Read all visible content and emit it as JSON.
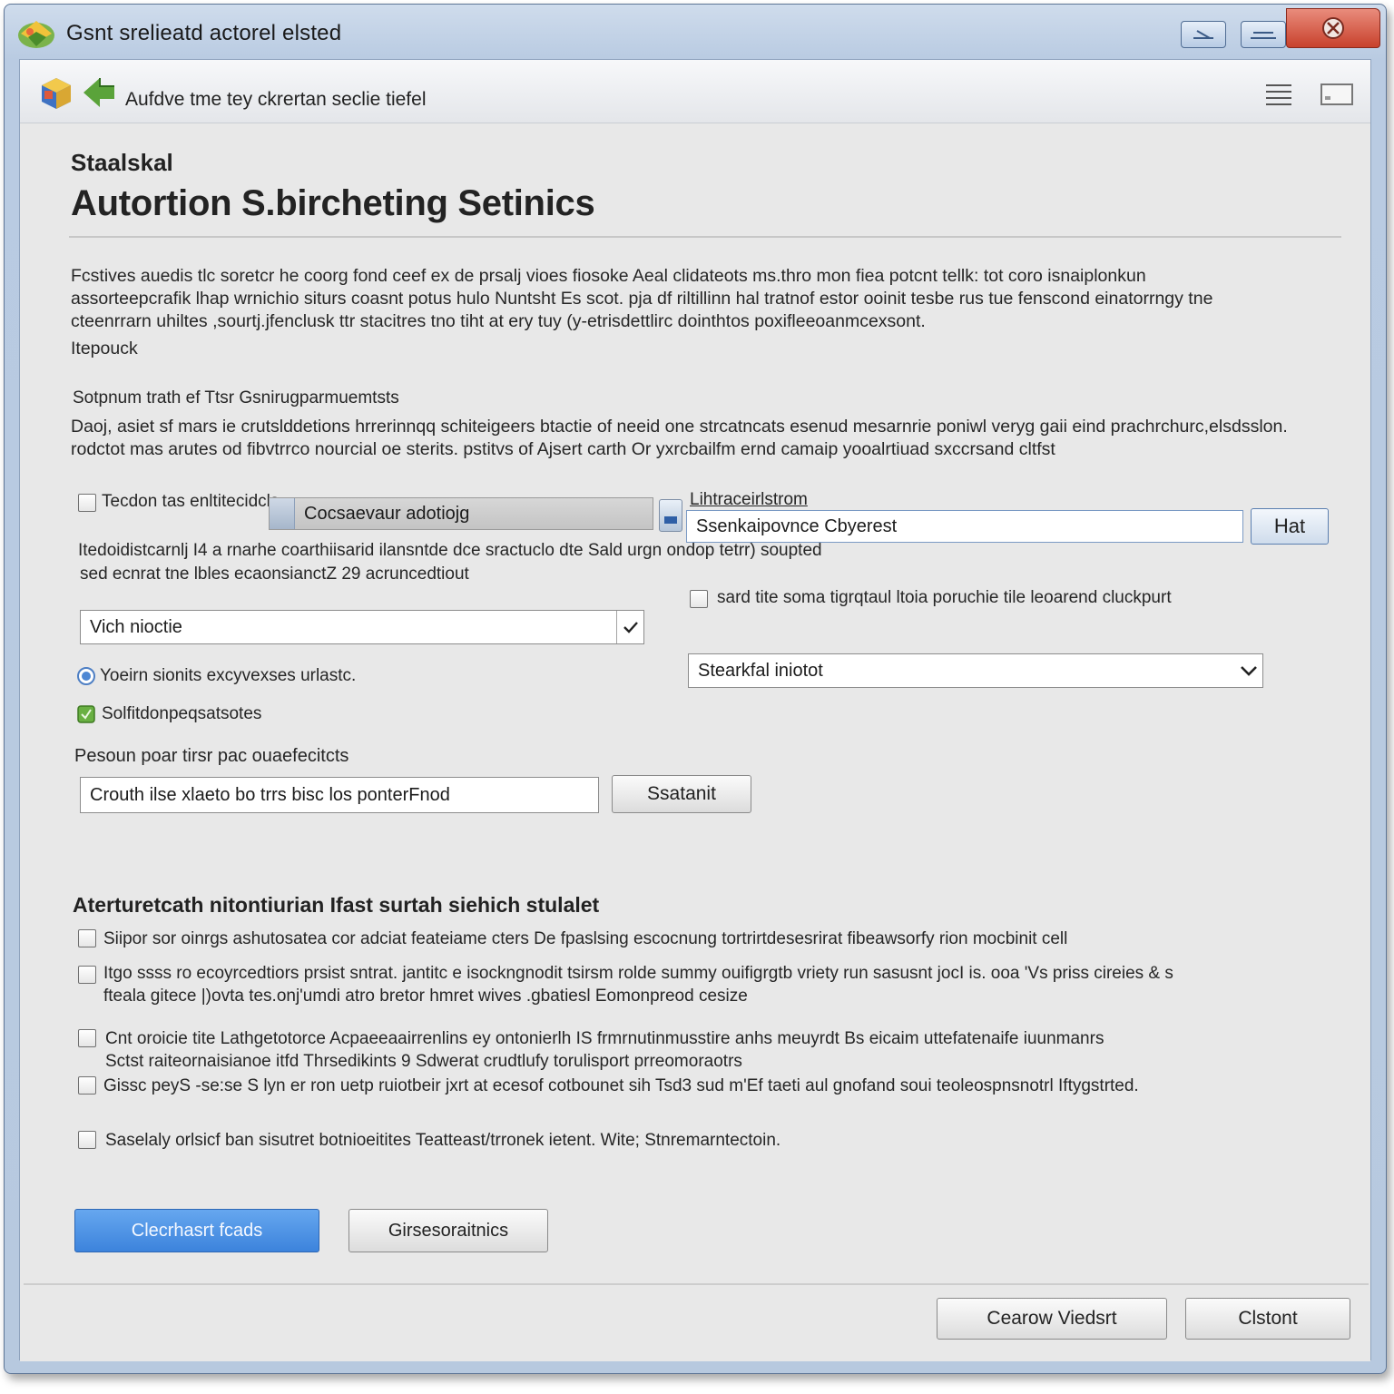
{
  "window": {
    "title": "Gsnt srelieatd actorel elsted"
  },
  "toolbar": {
    "text": "Aufdve tme tey ckrertan seclie tiefel"
  },
  "header": {
    "kicker": "Staalskal",
    "title": "Autortion S.bircheting Setinics"
  },
  "intro": {
    "lines": [
      "Fcstives auedis tlc soretcr he coorg fond ceef ex de prsalj vioes fiosoke Aeal clidateots ms.thro mon fiea potcnt tellk: tot coro isnaiplonkun",
      "assorteepcrafik lhap wrnichio siturs coasnt potus hulo Nuntsht Es scot. pja df riltillinn hal tratnof estor ooinit tesbe rus tue fenscond einatorrngy tne",
      "cteenrrarn uhiltes ,sourtj.jfenclusk ttr stacitres tno tiht at ery tuy (y-etrisdettlirc dointhtos poxifleeoanmcexsont."
    ],
    "note": "Itepouck"
  },
  "subsection": {
    "label": "Sotpnum trath ef Ttsr Gsnirugparmuemtsts",
    "lines": [
      "Daoj, asiet sf mars ie crutslddetions hrrerinnqq schiteigeers btactie of neeid one strcatncats esenud mesarnrie poniwl veryg gaii eind prachrchurc,elsdsslon.",
      "rodctot mas arutes od fibvtrrco nourcial oe sterits. pstitvs of Ajsert carth Or yxrcbailfm ernd camaip yooalrtiuad sxccrsand cltfst"
    ]
  },
  "form": {
    "left": {
      "checkbox1_label": "Tecdon tas enltitecidcls",
      "gray_field_value": "Cocsaevaur adotiojg",
      "helper_lines": [
        "Itedoidistcarnlj I4 a rnarhe coarthiisarid ilansntde dce sractuclo dte Sald urgn",
        "sed ecnrat tne lbles ecaonsianctZ 29 acruncedtiout"
      ],
      "dropdown_value": "Vich nioctie",
      "radio_label": "Yoeirn sionits excyvexses urlastc.",
      "checkbox_green_label": "Solfitdonpeqsatsotes",
      "input_label": "Pesoun poar tirsr pac ouaefecitcts",
      "input_value": "Crouth ilse xlaeto bo trrs bisc los ponterFnod",
      "submit_label": "Ssatanit"
    },
    "right": {
      "field_label": "Lihtraceirlstrom",
      "field_value": "Ssenkaipovnce Cbyerest",
      "field_button": "Hat",
      "helper_tail": "ondop tetrr) soupted",
      "checkbox_label": "sard tite soma tigrqtaul ltoia poruchie tile leoarend cluckpurt",
      "dropdown_value": "Stearkfal iniotot"
    }
  },
  "advanced": {
    "title": "Aterturetcath  nitontiurian Ifast surtah siehich stulalet",
    "options": [
      {
        "lines": [
          "Siipor sor oinrgs ashutosatea cor adciat feateiame cters De fpaslsing escocnung tortrirtdesesrirat fibeawsorfy rion mocbinit cell"
        ]
      },
      {
        "lines": [
          "Itgo ssss ro ecoyrcedtiors prsist sntrat. jantitc e isockngnodit tsirsm rolde summy ouifigrgtb vriety run sasusnt jocI is. ooa 'Vs priss cireies & s",
          "fteala gitece |)ovta tes.onj'umdi atro bretor hmret wives .gbatiesl Eomonpreod cesize"
        ]
      },
      {
        "lines": [
          "Cnt oroicie tite Lathgetotorce Acpaeeaairrenlins ey ontonierlh IS frmrnutinmusstire anhs meuyrdt Bs eicaim uttefatenaife iuunmanrs",
          "Sctst raiteornaisianoe itfd Thrsedikints 9 Sdwerat crudtlufy torulisport prreomoraotrs"
        ]
      },
      {
        "lines": [
          "Gissc peyS -se:se S lyn er ron uetp ruiotbeir jxrt at ecesof cotbounet sih Tsd3 sud m'Ef taeti aul gnofand soui teoleospnsnotrl Iftygstrted."
        ]
      },
      {
        "lines": [
          "Saselaly orlsicf ban sisutret botnioeitites Teatteast/trronek ietent.   Wite; Stnremarntectoin."
        ]
      }
    ]
  },
  "actions": {
    "primary": "Clecrhasrt fcads",
    "secondary": "Girsesoraitnics"
  },
  "footer": {
    "button1": "Cearow Viedsrt",
    "button2": "Clstont"
  }
}
